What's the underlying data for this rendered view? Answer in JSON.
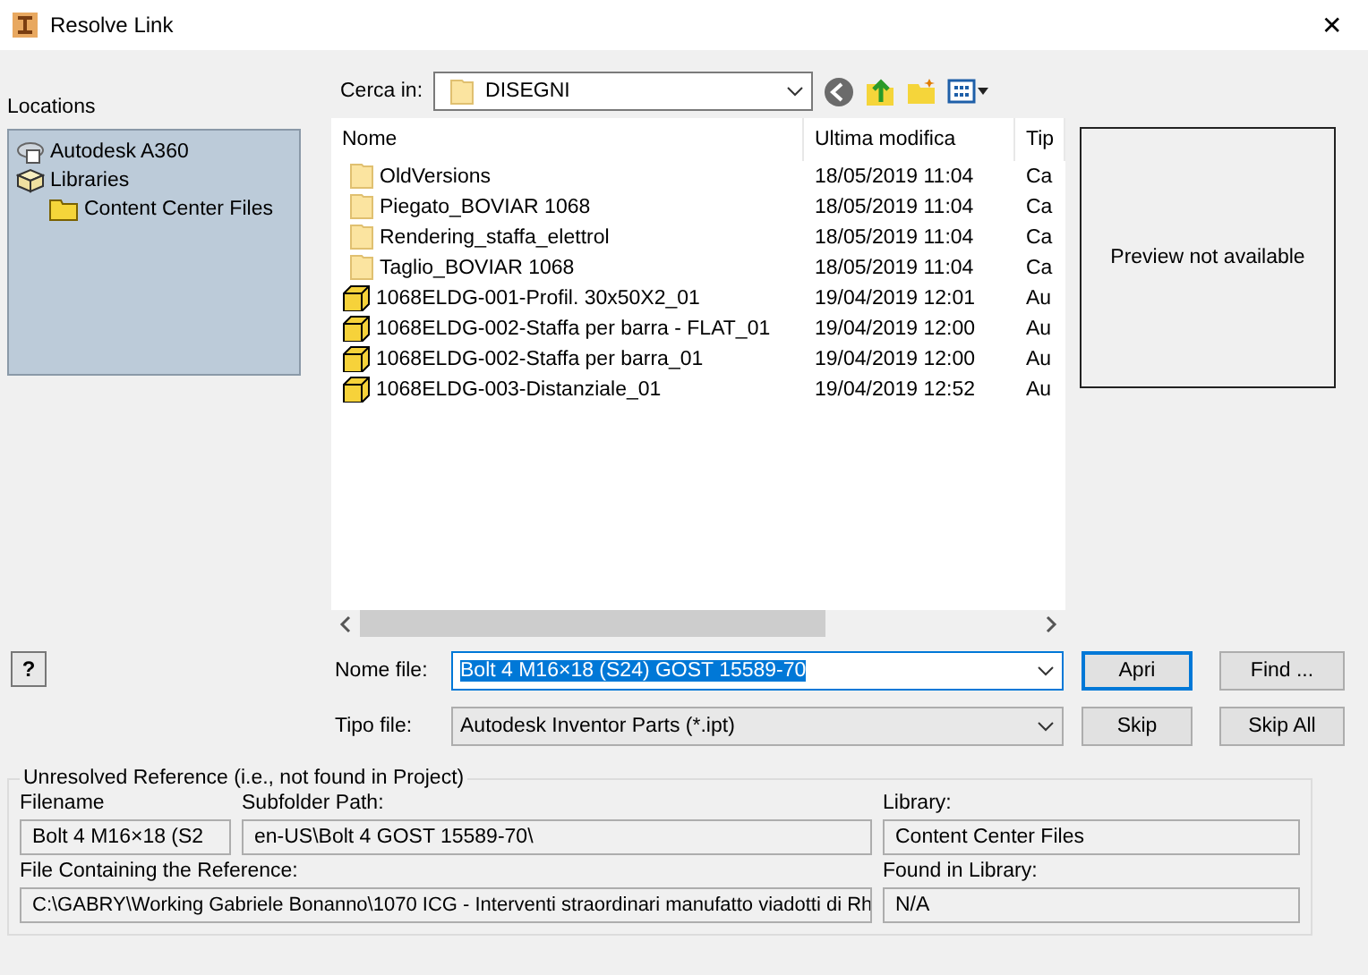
{
  "window": {
    "title": "Resolve Link",
    "close": "✕"
  },
  "locations": {
    "label": "Locations",
    "items": [
      {
        "name": "Autodesk A360",
        "kind": "cloud"
      },
      {
        "name": "Libraries",
        "kind": "library",
        "children": [
          {
            "name": "Content Center Files",
            "kind": "folder"
          }
        ]
      }
    ]
  },
  "look_in": {
    "label": "Cerca in:",
    "value": "DISEGNI"
  },
  "file_list": {
    "columns": [
      "Nome",
      "Ultima modifica",
      "Tip"
    ],
    "rows": [
      {
        "kind": "folder",
        "name": "OldVersions",
        "modified": "18/05/2019 11:04",
        "type": "Ca"
      },
      {
        "kind": "folder",
        "name": "Piegato_BOVIAR 1068",
        "modified": "18/05/2019 11:04",
        "type": "Ca"
      },
      {
        "kind": "folder",
        "name": "Rendering_staffa_elettrol",
        "modified": "18/05/2019 11:04",
        "type": "Ca"
      },
      {
        "kind": "folder",
        "name": "Taglio_BOVIAR 1068",
        "modified": "18/05/2019 11:04",
        "type": "Ca"
      },
      {
        "kind": "part",
        "name": "1068ELDG-001-Profil. 30x50X2_01",
        "modified": "19/04/2019 12:01",
        "type": "Au"
      },
      {
        "kind": "part",
        "name": "1068ELDG-002-Staffa per barra - FLAT_01",
        "modified": "19/04/2019 12:00",
        "type": "Au"
      },
      {
        "kind": "part",
        "name": "1068ELDG-002-Staffa per barra_01",
        "modified": "19/04/2019 12:00",
        "type": "Au"
      },
      {
        "kind": "part",
        "name": "1068ELDG-003-Distanziale_01",
        "modified": "19/04/2019 12:52",
        "type": "Au"
      }
    ]
  },
  "preview": {
    "text": "Preview not available"
  },
  "help_button": "?",
  "file_name": {
    "label": "Nome file:",
    "value": "Bolt 4 M16×18 (S24) GOST 15589-70"
  },
  "file_type": {
    "label": "Tipo file:",
    "value": "Autodesk Inventor Parts (*.ipt)"
  },
  "buttons": [
    {
      "label": "Apri",
      "default": true
    },
    {
      "label": "Find ...",
      "default": false
    },
    {
      "label": "Skip",
      "default": false
    },
    {
      "label": "Skip All",
      "default": false
    }
  ],
  "unresolved": {
    "title": "Unresolved Reference (i.e., not found in Project)",
    "filename": {
      "label": "Filename",
      "value": "Bolt 4 M16×18 (S2"
    },
    "subfolder": {
      "label": "Subfolder Path:",
      "value": "en-US\\Bolt 4 GOST 15589-70\\"
    },
    "library": {
      "label": "Library:",
      "value": "Content Center Files"
    },
    "containing": {
      "label": "File Containing the Reference:",
      "value": "C:\\GABRY\\Working Gabriele Bonanno\\1070 ICG - Interventi straordinari manufatto viadotti di Rh"
    },
    "found": {
      "label": "Found in Library:",
      "value": "N/A"
    }
  }
}
